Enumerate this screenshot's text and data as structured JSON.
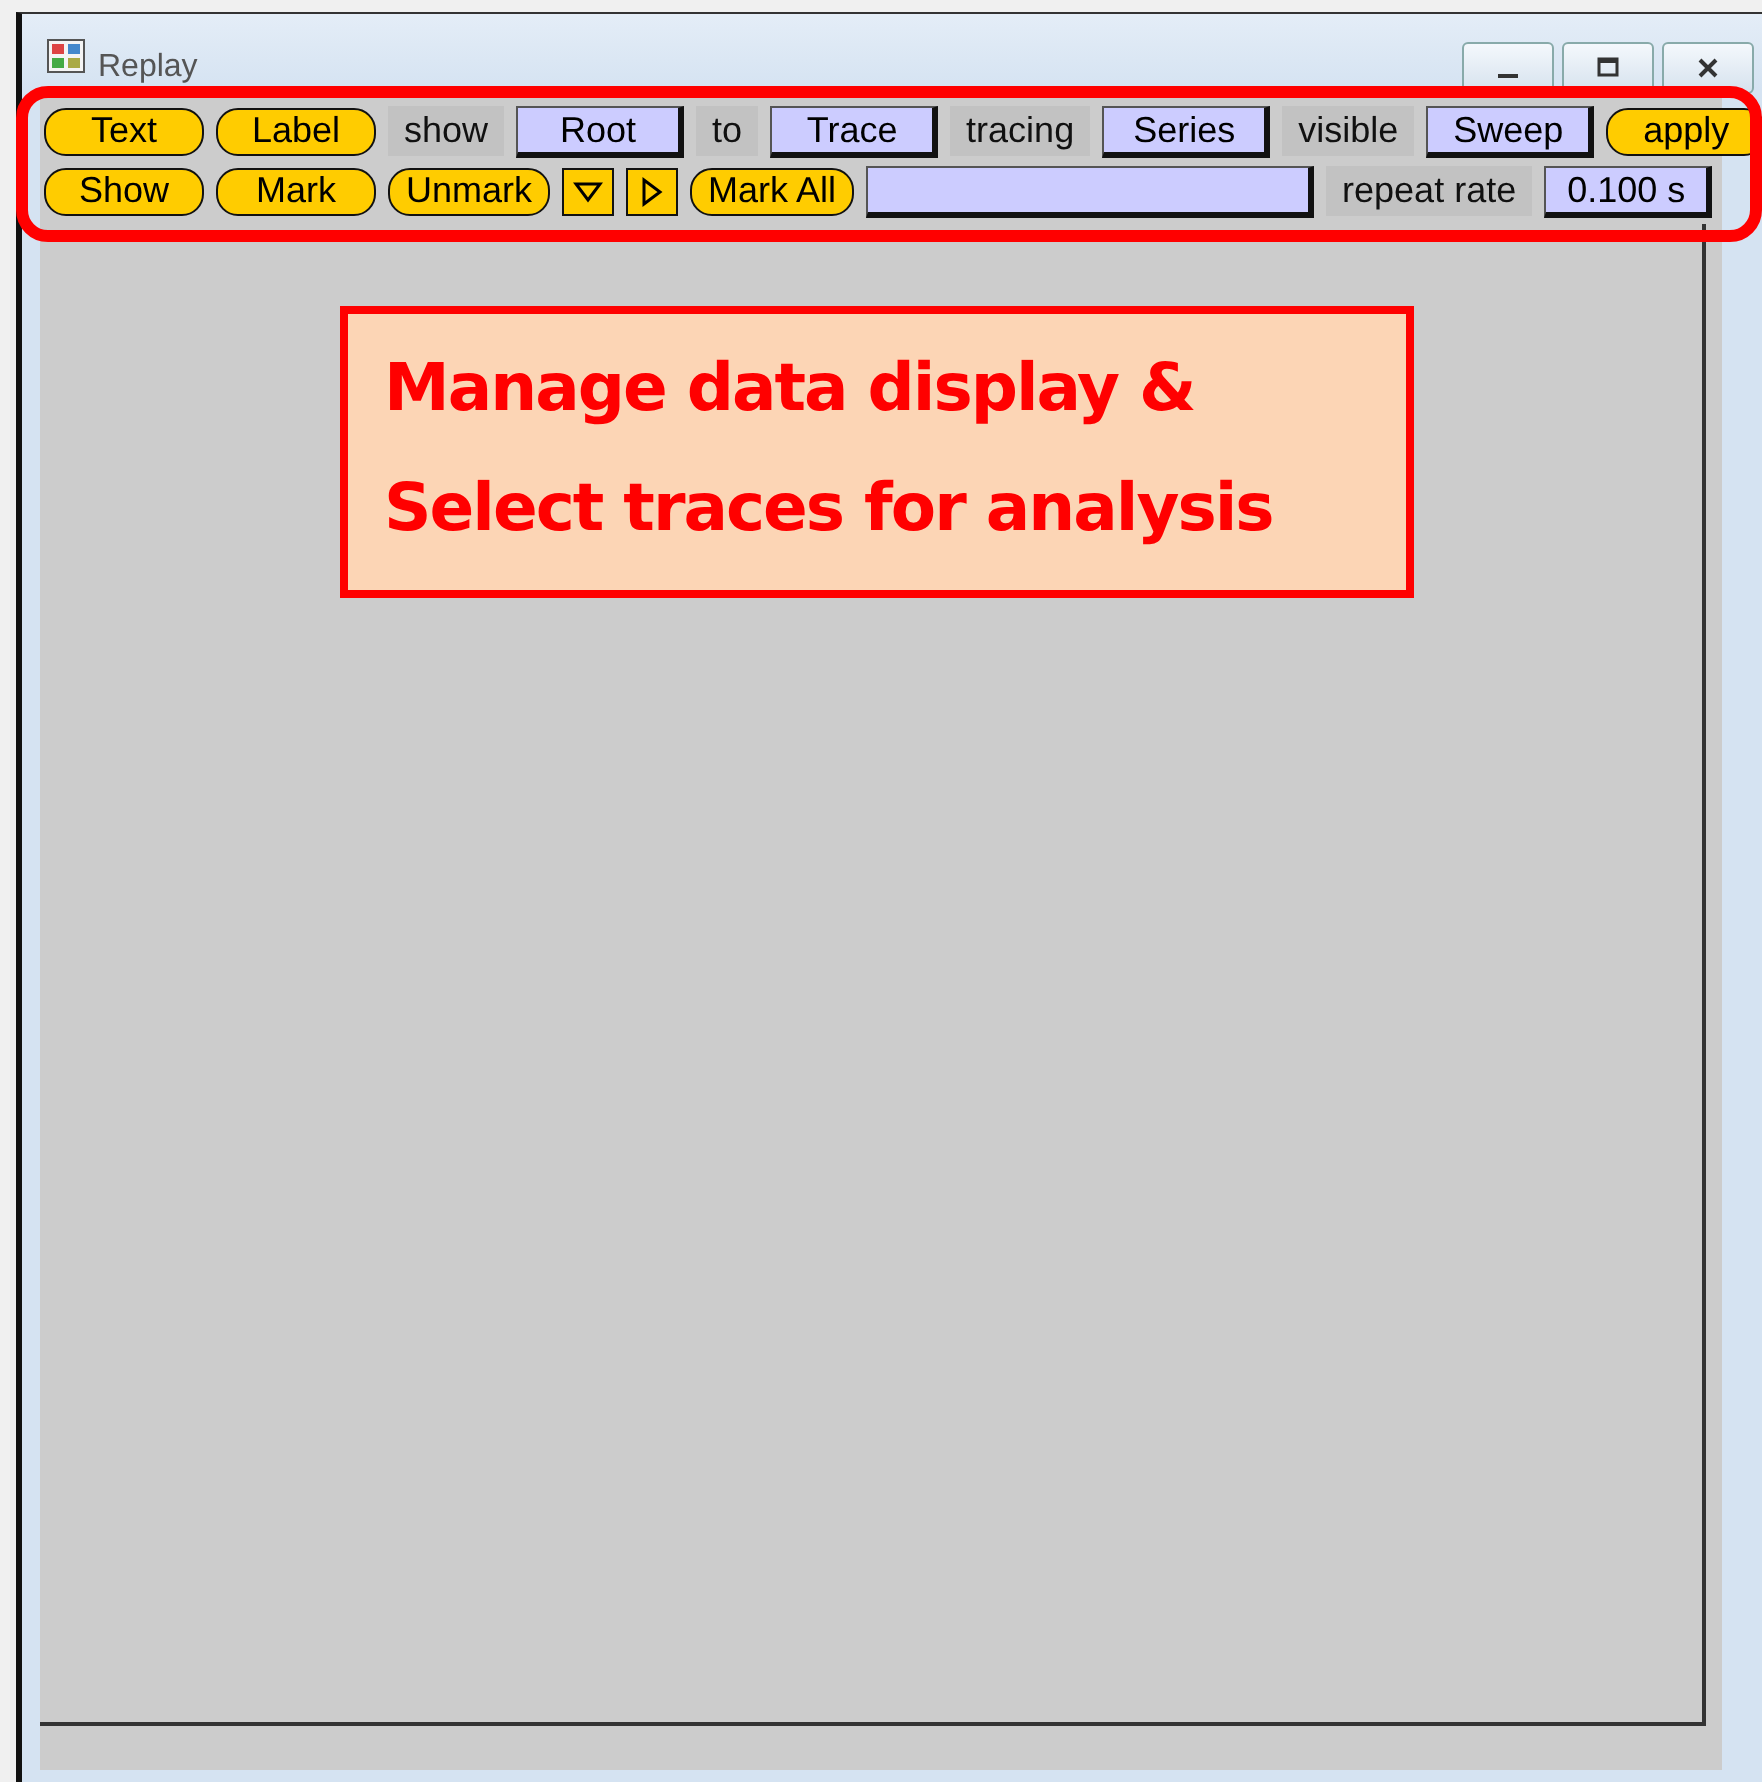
{
  "window": {
    "title": "Replay"
  },
  "toolbar": [
    [
      {
        "kind": "button",
        "label": "Text"
      },
      {
        "kind": "button",
        "label": "Label"
      },
      {
        "kind": "label",
        "label": "show"
      },
      {
        "kind": "field",
        "value": "Root"
      },
      {
        "kind": "label",
        "label": "to"
      },
      {
        "kind": "field",
        "value": "Trace"
      },
      {
        "kind": "label",
        "label": "tracing"
      },
      {
        "kind": "field",
        "value": "Series"
      },
      {
        "kind": "label",
        "label": "visible"
      },
      {
        "kind": "field",
        "value": "Sweep"
      },
      {
        "kind": "button",
        "label": "apply"
      }
    ],
    [
      {
        "kind": "button",
        "label": "Show"
      },
      {
        "kind": "button",
        "label": "Mark"
      },
      {
        "kind": "button",
        "label": "Unmark"
      },
      {
        "kind": "down-arrow"
      },
      {
        "kind": "right-arrow"
      },
      {
        "kind": "button",
        "label": "Mark All"
      },
      {
        "kind": "long-field"
      },
      {
        "kind": "label",
        "label": "repeat rate"
      },
      {
        "kind": "field",
        "value": "0.100 s"
      }
    ]
  ],
  "callout": {
    "lines": [
      "Manage data display &",
      "Select traces for analysis"
    ]
  }
}
